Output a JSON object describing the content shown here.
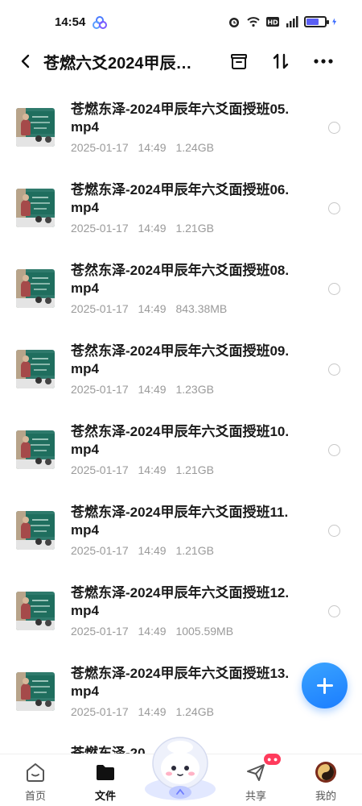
{
  "status_bar": {
    "time": "14:54",
    "battery_level": 0.7,
    "battery_color": "#5b5ff5"
  },
  "header": {
    "title": "苍燃六爻2024甲辰…",
    "back_icon": "chevron-left-icon",
    "actions": [
      "archive-box-icon",
      "sort-icon",
      "more-icon"
    ]
  },
  "files": [
    {
      "name": "苍燃东泽-2024甲辰年六爻面授班05.mp4",
      "date": "2025-01-17",
      "time": "14:49",
      "size": "1.24GB"
    },
    {
      "name": "苍燃东泽-2024甲辰年六爻面授班06.mp4",
      "date": "2025-01-17",
      "time": "14:49",
      "size": "1.21GB"
    },
    {
      "name": "苍然东泽-2024甲辰年六爻面授班08.mp4",
      "date": "2025-01-17",
      "time": "14:49",
      "size": "843.38MB"
    },
    {
      "name": "苍然东泽-2024甲辰年六爻面授班09.mp4",
      "date": "2025-01-17",
      "time": "14:49",
      "size": "1.23GB"
    },
    {
      "name": "苍然东泽-2024甲辰年六爻面授班10.mp4",
      "date": "2025-01-17",
      "time": "14:49",
      "size": "1.21GB"
    },
    {
      "name": "苍燃东泽-2024甲辰年六爻面授班11.mp4",
      "date": "2025-01-17",
      "time": "14:49",
      "size": "1.21GB"
    },
    {
      "name": "苍燃东泽-2024甲辰年六爻面授班12.mp4",
      "date": "2025-01-17",
      "time": "14:49",
      "size": "1005.59MB"
    },
    {
      "name": "苍燃东泽-2024甲辰年六爻面授班13.mp4",
      "date": "2025-01-17",
      "time": "14:49",
      "size": "1.24GB"
    }
  ],
  "partial_row_text": "苍燃东泽-20",
  "fab_icon": "plus-icon",
  "bottom_nav": {
    "home": "首页",
    "files": "文件",
    "share": "共享",
    "mine": "我的"
  },
  "colors": {
    "accent": "#1b7dff",
    "meta_text": "#9a9a9a"
  }
}
